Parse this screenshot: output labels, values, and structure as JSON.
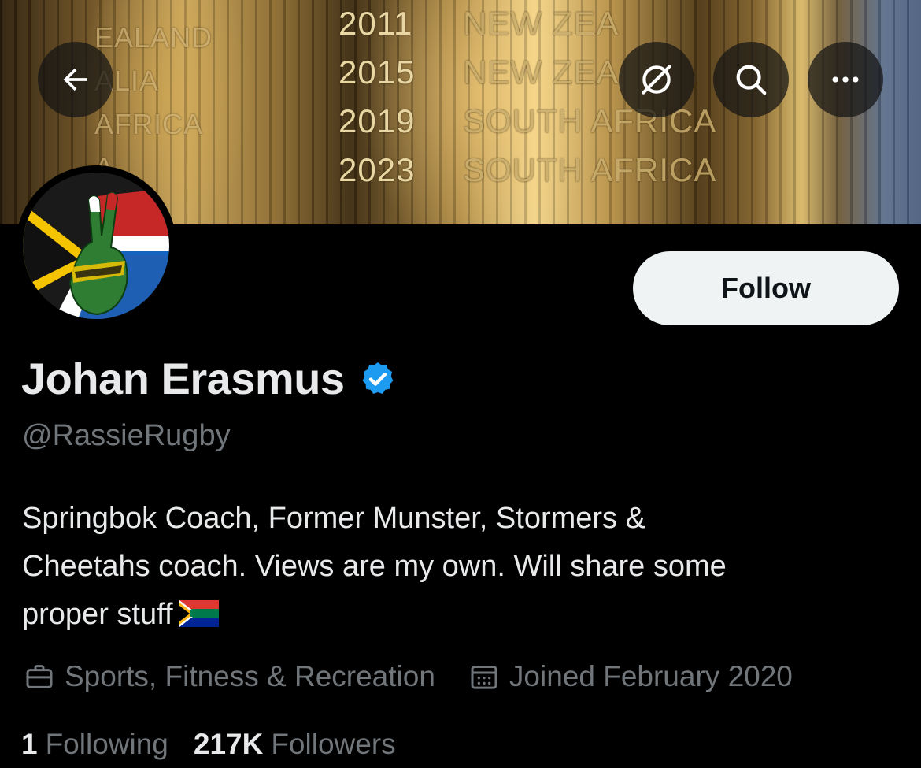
{
  "banner": {
    "years": [
      "2011",
      "2015",
      "2019",
      "2023"
    ],
    "countries": [
      "NEW ZEA",
      "NEW ZEA",
      "SOUTH AFRICA",
      "SOUTH AFRICA"
    ],
    "left_engravings": [
      "EALAND",
      "ALIA",
      "AFRICA",
      "A"
    ]
  },
  "header_icons": {
    "back": "back-arrow-icon",
    "grok": "grok-icon",
    "search": "search-icon",
    "more": "more-icon"
  },
  "profile": {
    "follow_label": "Follow",
    "name": "Johan Erasmus",
    "handle": "@RassieRugby",
    "bio_line1": "Springbok Coach, Former Munster, Stormers &",
    "bio_line2": "Cheetahs coach. Views are my own. Will share some",
    "bio_line3": "proper stuff",
    "category": "Sports, Fitness & Recreation",
    "joined": "Joined February 2020",
    "following_count": "1",
    "following_label": "Following",
    "followers_count": "217K",
    "followers_label": "Followers"
  },
  "colors": {
    "verified_blue": "#1d9bf0",
    "secondary_text": "#71767b",
    "primary_text": "#e7e9ea",
    "follow_button_bg": "#eff3f4"
  }
}
